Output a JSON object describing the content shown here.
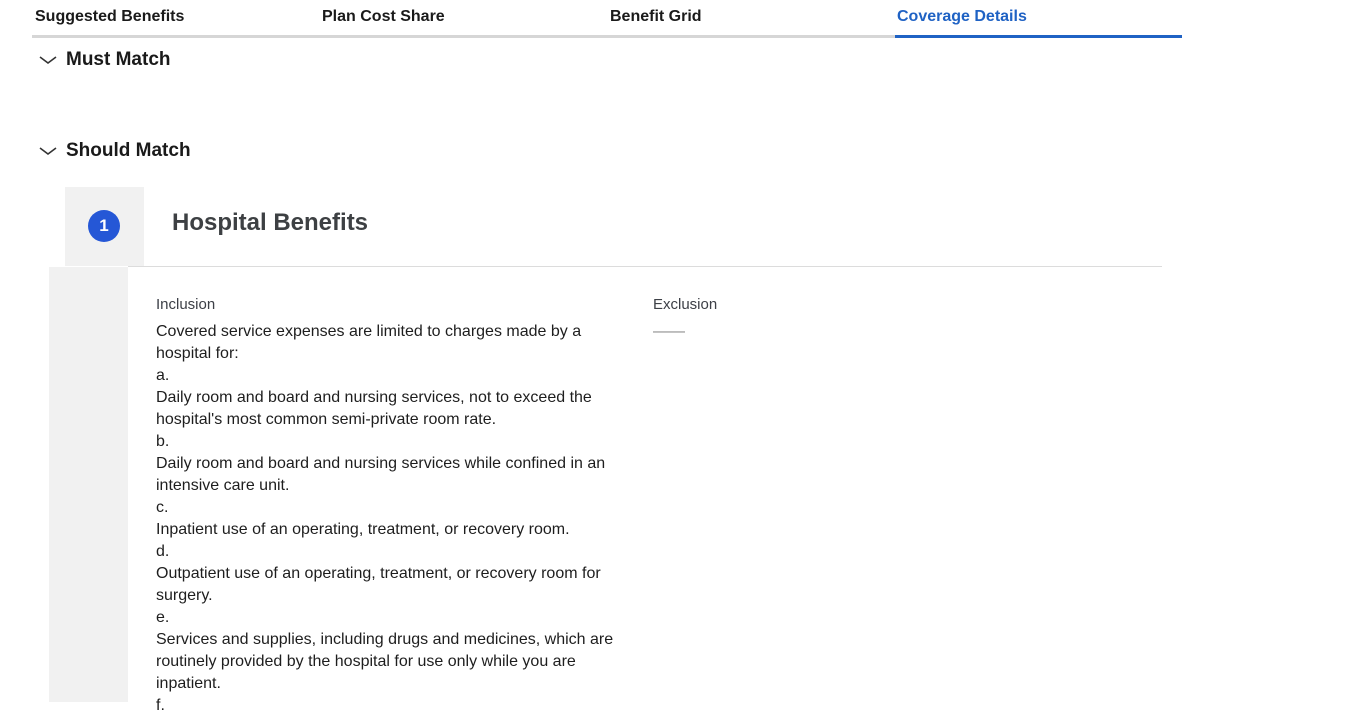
{
  "tabs": [
    {
      "label": "Suggested Benefits",
      "active": false
    },
    {
      "label": "Plan Cost Share",
      "active": false
    },
    {
      "label": "Benefit Grid",
      "active": false
    },
    {
      "label": "Coverage Details",
      "active": true
    }
  ],
  "sections": {
    "must_match": {
      "title": "Must Match",
      "expanded": true,
      "icon": "chevron-down-icon"
    },
    "should_match": {
      "title": "Should Match",
      "expanded": true,
      "icon": "chevron-down-icon"
    }
  },
  "benefit_card": {
    "number": "1",
    "title": "Hospital Benefits",
    "inclusion_label": "Inclusion",
    "exclusion_label": "Exclusion",
    "exclusion_value": "——",
    "inclusion_lines": [
      "Covered service expenses are limited to charges made by a hospital for:",
      "a.",
      "Daily room and board and nursing services, not to exceed the hospital's most common semi-private room rate.",
      "b.",
      "Daily room and board and nursing services while confined in an intensive care unit.",
      "c.",
      "Inpatient use of an operating, treatment, or recovery room.",
      "d.",
      "Outpatient use of an operating, treatment, or recovery room for surgery.",
      "e.",
      "Services and supplies, including drugs and medicines, which are routinely provided by the hospital for use only while you are inpatient.",
      "f."
    ]
  },
  "colors": {
    "accent": "#1f62c4",
    "badge": "#2557d6",
    "panel_bg": "#f1f1f1"
  }
}
